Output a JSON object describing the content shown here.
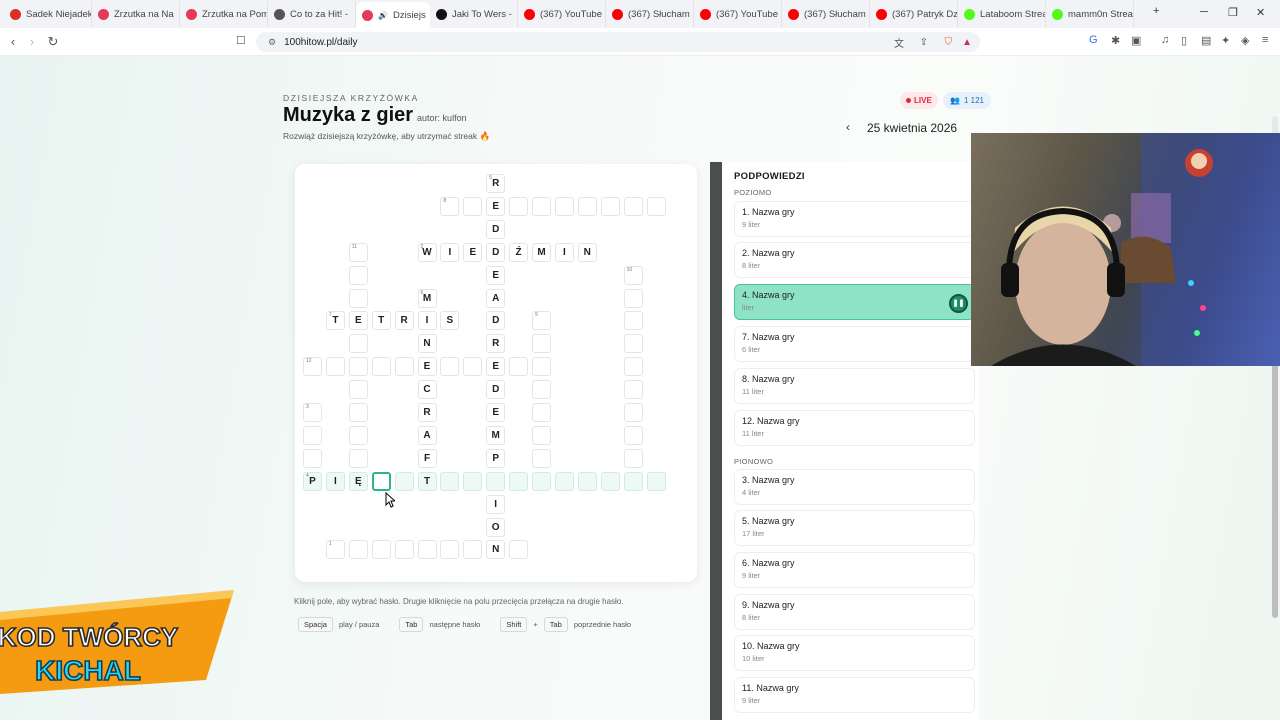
{
  "browser": {
    "tabs": [
      {
        "label": "Sadek Niejadek",
        "fav": "#d93025",
        "active": false
      },
      {
        "label": "Zrzutka na Na",
        "fav": "#e53955",
        "active": false
      },
      {
        "label": "Zrzutka na Pom",
        "fav": "#e53955",
        "active": false
      },
      {
        "label": "Co to za Hit! -",
        "fav": "#555555",
        "active": false
      },
      {
        "label": "Dzisiejs",
        "fav": "#e53955",
        "active": true
      },
      {
        "label": "Jaki To Wers -",
        "fav": "#111111",
        "active": false
      },
      {
        "label": "(367) YouTube",
        "fav": "#ff0000",
        "active": false
      },
      {
        "label": "(367) Słucham",
        "fav": "#ff0000",
        "active": false
      },
      {
        "label": "(367) YouTube",
        "fav": "#ff0000",
        "active": false
      },
      {
        "label": "(367) Słucham",
        "fav": "#ff0000",
        "active": false
      },
      {
        "label": "(367) Patryk Dz",
        "fav": "#ff0000",
        "active": false
      },
      {
        "label": "Lataboom Strea",
        "fav": "#53fc18",
        "active": false
      },
      {
        "label": "mamm0n Strea",
        "fav": "#53fc18",
        "active": false
      }
    ],
    "url": "100hitow.pl/daily"
  },
  "header": {
    "kicker": "DZISIEJSZA KRZYŻÓWKA",
    "title": "Muzyka z gier",
    "author": "autor: kulfon",
    "subtitle": "Rozwiąż dzisiejszą krzyżówkę, aby utrzymać streak 🔥",
    "live_label": "LIVE",
    "players": "1 121",
    "date": "25 kwietnia 2026"
  },
  "grid": {
    "cells": [
      {
        "c": 8,
        "r": 0,
        "ch": "R",
        "n": "5"
      },
      {
        "c": 6,
        "r": 1,
        "ch": "",
        "n": "8"
      },
      {
        "c": 7,
        "r": 1,
        "ch": ""
      },
      {
        "c": 8,
        "r": 1,
        "ch": "E"
      },
      {
        "c": 9,
        "r": 1,
        "ch": ""
      },
      {
        "c": 10,
        "r": 1,
        "ch": ""
      },
      {
        "c": 11,
        "r": 1,
        "ch": ""
      },
      {
        "c": 12,
        "r": 1,
        "ch": ""
      },
      {
        "c": 13,
        "r": 1,
        "ch": ""
      },
      {
        "c": 14,
        "r": 1,
        "ch": ""
      },
      {
        "c": 15,
        "r": 1,
        "ch": ""
      },
      {
        "c": 8,
        "r": 2,
        "ch": "D"
      },
      {
        "c": 2,
        "r": 3,
        "ch": "",
        "n": "11"
      },
      {
        "c": 5,
        "r": 3,
        "ch": "W",
        "n": "2"
      },
      {
        "c": 6,
        "r": 3,
        "ch": "I"
      },
      {
        "c": 7,
        "r": 3,
        "ch": "E"
      },
      {
        "c": 8,
        "r": 3,
        "ch": "D"
      },
      {
        "c": 9,
        "r": 3,
        "ch": "Ź"
      },
      {
        "c": 10,
        "r": 3,
        "ch": "M"
      },
      {
        "c": 11,
        "r": 3,
        "ch": "I"
      },
      {
        "c": 12,
        "r": 3,
        "ch": "N"
      },
      {
        "c": 2,
        "r": 4,
        "ch": ""
      },
      {
        "c": 8,
        "r": 4,
        "ch": "E"
      },
      {
        "c": 14,
        "r": 4,
        "ch": "",
        "n": "10"
      },
      {
        "c": 2,
        "r": 5,
        "ch": ""
      },
      {
        "c": 5,
        "r": 5,
        "ch": "M",
        "n": "6"
      },
      {
        "c": 8,
        "r": 5,
        "ch": "A"
      },
      {
        "c": 14,
        "r": 5,
        "ch": ""
      },
      {
        "c": 1,
        "r": 6,
        "ch": "T",
        "n": "7"
      },
      {
        "c": 2,
        "r": 6,
        "ch": "E"
      },
      {
        "c": 3,
        "r": 6,
        "ch": "T"
      },
      {
        "c": 4,
        "r": 6,
        "ch": "R"
      },
      {
        "c": 5,
        "r": 6,
        "ch": "I"
      },
      {
        "c": 6,
        "r": 6,
        "ch": "S"
      },
      {
        "c": 8,
        "r": 6,
        "ch": "D"
      },
      {
        "c": 10,
        "r": 6,
        "ch": "",
        "n": "9"
      },
      {
        "c": 14,
        "r": 6,
        "ch": ""
      },
      {
        "c": 2,
        "r": 7,
        "ch": ""
      },
      {
        "c": 5,
        "r": 7,
        "ch": "N"
      },
      {
        "c": 8,
        "r": 7,
        "ch": "R"
      },
      {
        "c": 10,
        "r": 7,
        "ch": ""
      },
      {
        "c": 14,
        "r": 7,
        "ch": ""
      },
      {
        "c": 0,
        "r": 8,
        "ch": "",
        "n": "12"
      },
      {
        "c": 1,
        "r": 8,
        "ch": ""
      },
      {
        "c": 2,
        "r": 8,
        "ch": ""
      },
      {
        "c": 3,
        "r": 8,
        "ch": ""
      },
      {
        "c": 4,
        "r": 8,
        "ch": ""
      },
      {
        "c": 5,
        "r": 8,
        "ch": "E"
      },
      {
        "c": 6,
        "r": 8,
        "ch": ""
      },
      {
        "c": 7,
        "r": 8,
        "ch": ""
      },
      {
        "c": 8,
        "r": 8,
        "ch": "E"
      },
      {
        "c": 9,
        "r": 8,
        "ch": ""
      },
      {
        "c": 10,
        "r": 8,
        "ch": ""
      },
      {
        "c": 14,
        "r": 8,
        "ch": ""
      },
      {
        "c": 2,
        "r": 9,
        "ch": ""
      },
      {
        "c": 5,
        "r": 9,
        "ch": "C"
      },
      {
        "c": 8,
        "r": 9,
        "ch": "D"
      },
      {
        "c": 10,
        "r": 9,
        "ch": ""
      },
      {
        "c": 14,
        "r": 9,
        "ch": ""
      },
      {
        "c": 0,
        "r": 10,
        "ch": "",
        "n": "3"
      },
      {
        "c": 2,
        "r": 10,
        "ch": ""
      },
      {
        "c": 5,
        "r": 10,
        "ch": "R"
      },
      {
        "c": 8,
        "r": 10,
        "ch": "E"
      },
      {
        "c": 10,
        "r": 10,
        "ch": ""
      },
      {
        "c": 14,
        "r": 10,
        "ch": ""
      },
      {
        "c": 0,
        "r": 11,
        "ch": ""
      },
      {
        "c": 2,
        "r": 11,
        "ch": ""
      },
      {
        "c": 5,
        "r": 11,
        "ch": "A"
      },
      {
        "c": 8,
        "r": 11,
        "ch": "M"
      },
      {
        "c": 10,
        "r": 11,
        "ch": ""
      },
      {
        "c": 14,
        "r": 11,
        "ch": ""
      },
      {
        "c": 0,
        "r": 12,
        "ch": ""
      },
      {
        "c": 2,
        "r": 12,
        "ch": ""
      },
      {
        "c": 5,
        "r": 12,
        "ch": "F"
      },
      {
        "c": 8,
        "r": 12,
        "ch": "P"
      },
      {
        "c": 10,
        "r": 12,
        "ch": ""
      },
      {
        "c": 14,
        "r": 12,
        "ch": ""
      },
      {
        "c": 0,
        "r": 13,
        "ch": "P",
        "n": "4",
        "hl": true
      },
      {
        "c": 1,
        "r": 13,
        "ch": "I",
        "hl": true
      },
      {
        "c": 2,
        "r": 13,
        "ch": "Ę",
        "hl": true
      },
      {
        "c": 3,
        "r": 13,
        "ch": "",
        "act": true
      },
      {
        "c": 4,
        "r": 13,
        "ch": "",
        "hl": true
      },
      {
        "c": 5,
        "r": 13,
        "ch": "T",
        "hl": true
      },
      {
        "c": 6,
        "r": 13,
        "ch": "",
        "hl": true
      },
      {
        "c": 7,
        "r": 13,
        "ch": "",
        "hl": true
      },
      {
        "c": 8,
        "r": 13,
        "ch": "",
        "hl": true
      },
      {
        "c": 9,
        "r": 13,
        "ch": "",
        "hl": true
      },
      {
        "c": 10,
        "r": 13,
        "ch": "",
        "hl": true
      },
      {
        "c": 11,
        "r": 13,
        "ch": "",
        "hl": true
      },
      {
        "c": 12,
        "r": 13,
        "ch": "",
        "hl": true
      },
      {
        "c": 13,
        "r": 13,
        "ch": "",
        "hl": true
      },
      {
        "c": 14,
        "r": 13,
        "ch": "",
        "hl": true
      },
      {
        "c": 15,
        "r": 13,
        "ch": "",
        "hl": true
      },
      {
        "c": 8,
        "r": 14,
        "ch": "I"
      },
      {
        "c": 8,
        "r": 15,
        "ch": "O"
      },
      {
        "c": 1,
        "r": 16,
        "ch": "",
        "n": "1"
      },
      {
        "c": 2,
        "r": 16,
        "ch": ""
      },
      {
        "c": 3,
        "r": 16,
        "ch": ""
      },
      {
        "c": 4,
        "r": 16,
        "ch": ""
      },
      {
        "c": 5,
        "r": 16,
        "ch": ""
      },
      {
        "c": 6,
        "r": 16,
        "ch": ""
      },
      {
        "c": 7,
        "r": 16,
        "ch": ""
      },
      {
        "c": 8,
        "r": 16,
        "ch": "N"
      },
      {
        "c": 9,
        "r": 16,
        "ch": ""
      }
    ]
  },
  "instructions": {
    "hint": "Kliknij pole, aby wybrać hasło. Drugie kliknięcie na polu przecięcia przełącza na drugie hasło.",
    "key_space": "Spacja",
    "key_space_desc": "play / pauza",
    "key_tab": "Tab",
    "key_tab_desc": "następne hasło",
    "key_shift": "Shift",
    "key_plus": "+",
    "key_tab2": "Tab",
    "key_shift_desc": "poprzednie hasło"
  },
  "clues": {
    "title": "PODPOWIEDZI",
    "across_label": "POZIOMO",
    "down_label": "PIONOWO",
    "across": [
      {
        "title": "1. Nazwa gry",
        "len": "9 liter"
      },
      {
        "title": "2. Nazwa gry",
        "len": "8 liter"
      },
      {
        "title": "4. Nazwa gry",
        "len": "liter",
        "active": true
      },
      {
        "title": "7. Nazwa gry",
        "len": "6 liter"
      },
      {
        "title": "8. Nazwa gry",
        "len": "11 liter"
      },
      {
        "title": "12. Nazwa gry",
        "len": "11 liter"
      }
    ],
    "down": [
      {
        "title": "3. Nazwa gry",
        "len": "4 liter"
      },
      {
        "title": "5. Nazwa gry",
        "len": "17 liter"
      },
      {
        "title": "6. Nazwa gry",
        "len": "9 liter"
      },
      {
        "title": "9. Nazwa gry",
        "len": "8 liter"
      },
      {
        "title": "10. Nazwa gry",
        "len": "10 liter"
      },
      {
        "title": "11. Nazwa gry",
        "len": "9 liter"
      }
    ]
  },
  "banner": {
    "line1": "KOD TWÓRCY",
    "line2": "KICHAL"
  },
  "colors": {
    "accent": "#2eb38d",
    "active_clue": "#8ee2c6",
    "live": "#e0283c",
    "banner": "#f59b12"
  }
}
